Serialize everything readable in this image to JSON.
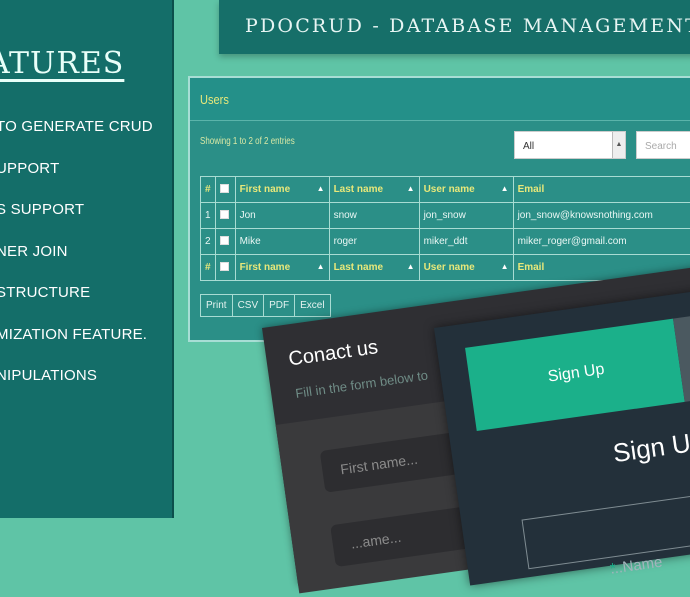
{
  "features": {
    "title": "ATURES",
    "items": [
      "TO GENERATE CRUD",
      "UPPORT",
      "S SUPPORT",
      "NER JOIN",
      "STRUCTURE",
      "MIZATION FEATURE.",
      "NIPULATIONS"
    ]
  },
  "banner": {
    "title": "PDOCRUD - DATABASE MANAGEMENT SYS"
  },
  "users": {
    "title": "Users",
    "showing": "Showing 1 to 2 of 2 entries",
    "select_value": "All",
    "search_placeholder": "Search",
    "columns": [
      "#",
      "",
      "First name",
      "Last name",
      "User name",
      "Email"
    ],
    "rows": [
      {
        "num": "1",
        "first": "Jon",
        "last": "snow",
        "user": "jon_snow",
        "email": "jon_snow@knowsnothing.com"
      },
      {
        "num": "2",
        "first": "Mike",
        "last": "roger",
        "user": "miker_ddt",
        "email": "miker_roger@gmail.com"
      }
    ],
    "buttons": [
      "Print",
      "CSV",
      "PDF",
      "Excel"
    ]
  },
  "contact": {
    "title": "Conact us",
    "subtitle": "Fill in the form below to",
    "first_name_placeholder": "First name...",
    "second_placeholder": "...ame..."
  },
  "signup": {
    "tab_label": "Sign Up",
    "heading": "Sign Up f",
    "field_label": "...Name",
    "required_mark": "*"
  },
  "colors": {
    "background": "#5fc4a6",
    "panel": "#146e69",
    "accent_green": "#1bb08a",
    "header_text": "#e8e87a"
  }
}
